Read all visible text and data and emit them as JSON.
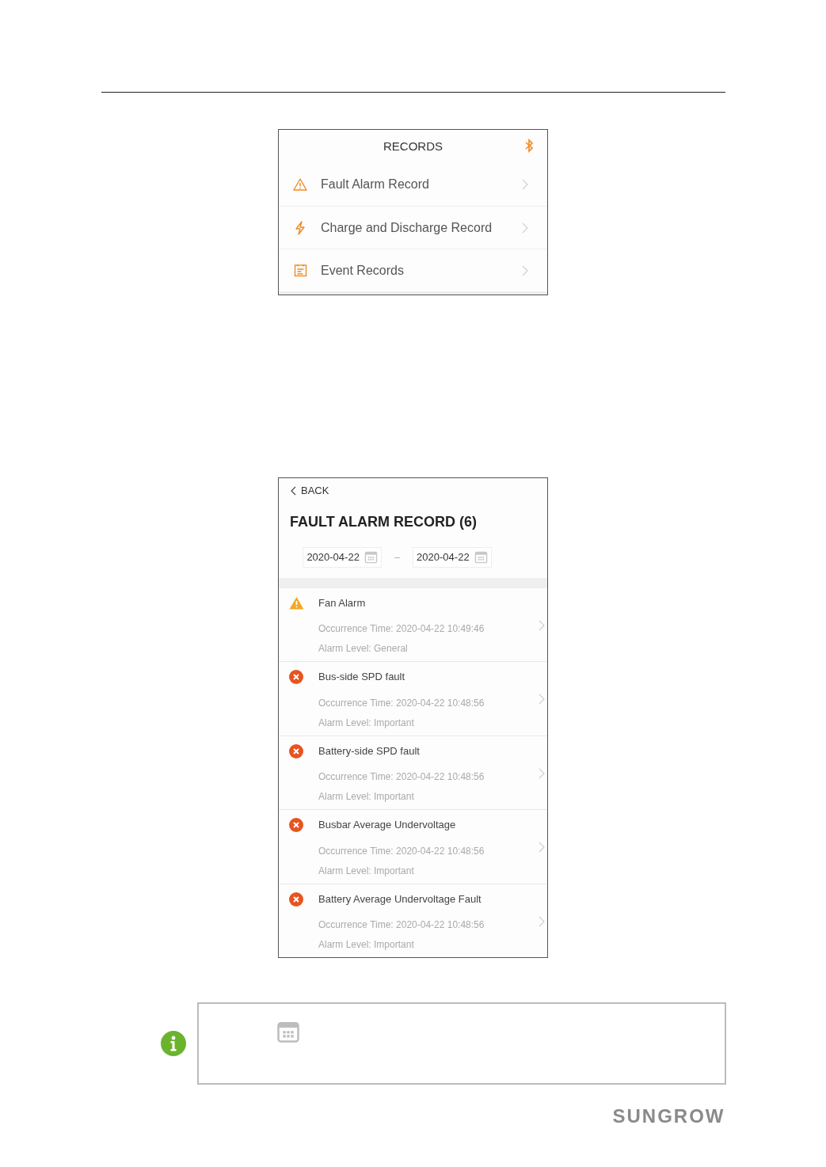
{
  "records_screen": {
    "title": "RECORDS",
    "items": [
      {
        "kind": "warning",
        "label": "Fault Alarm Record"
      },
      {
        "kind": "bolt",
        "label": "Charge and Discharge Record"
      },
      {
        "kind": "list",
        "label": "Event Records"
      }
    ]
  },
  "fault_screen": {
    "back": "BACK",
    "title": "FAULT ALARM RECORD (6)",
    "date_from": "2020-04-22",
    "date_separator": "–",
    "date_to": "2020-04-22",
    "alarms": [
      {
        "kind": "warning",
        "name": "Fan Alarm",
        "time": "Occurrence Time: 2020-04-22 10:49:46",
        "level": "Alarm Level: General"
      },
      {
        "kind": "fault",
        "name": "Bus-side SPD fault",
        "time": "Occurrence Time: 2020-04-22 10:48:56",
        "level": "Alarm Level: Important"
      },
      {
        "kind": "fault",
        "name": "Battery-side SPD fault",
        "time": "Occurrence Time: 2020-04-22 10:48:56",
        "level": "Alarm Level: Important"
      },
      {
        "kind": "fault",
        "name": "Busbar Average Undervoltage",
        "time": "Occurrence Time: 2020-04-22 10:48:56",
        "level": "Alarm Level: Important"
      },
      {
        "kind": "fault",
        "name": "Battery Average Undervoltage Fault",
        "time": "Occurrence Time: 2020-04-22 10:48:56",
        "level": "Alarm Level: Important"
      }
    ]
  },
  "brand": "SUNGROW"
}
